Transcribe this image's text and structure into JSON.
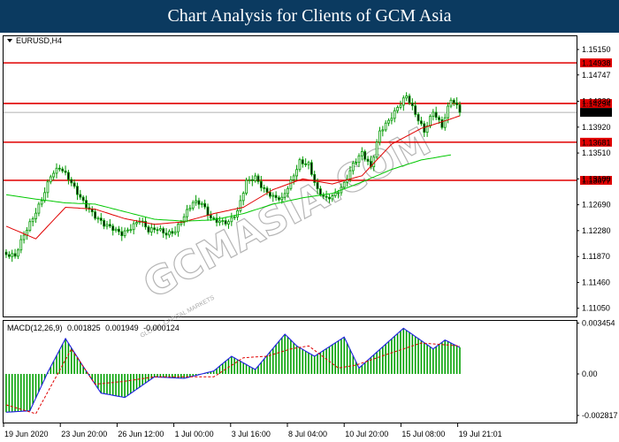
{
  "header": {
    "title": "Chart Analysis for Clients of GCM Asia"
  },
  "watermark": {
    "text": "GCMASIA.COM",
    "subtext": "GLOBAL CAPITAL MARKETS"
  },
  "colors": {
    "banner": "#0b3a60",
    "candle": "#009900",
    "level_line": "#e00000",
    "level_tag": "#e00000",
    "current_tag": "#000000",
    "ma_fast": "#e00000",
    "ma_slow": "#00c800",
    "macd_line": "#2020e0",
    "macd_signal": "#e00000",
    "macd_hist": "#00a000"
  },
  "chart_data": [
    {
      "type": "candlestick",
      "title": "EURUSD,H4",
      "ylim": [
        1.1092,
        1.1536
      ],
      "y_ticks": [
        "1.15150",
        "1.14747",
        "1.14330",
        "1.13920",
        "1.13510",
        "1.13100",
        "1.12690",
        "1.12280",
        "1.11870",
        "1.11460",
        "1.11050"
      ],
      "x_ticks": [
        "19 Jun 2020",
        "23 Jun 20:00",
        "26 Jun 12:00",
        "1 Jul 00:00",
        "3 Jul 16:00",
        "8 Jul 04:00",
        "10 Jul 20:00",
        "15 Jul 08:00",
        "19 Jul 21:01"
      ],
      "levels": [
        "1.14938",
        "1.14294",
        "1.13681",
        "1.13077"
      ],
      "current_price": "1.14154",
      "close_anchors": [
        [
          0,
          1.119
        ],
        [
          3,
          1.1185
        ],
        [
          6,
          1.122
        ],
        [
          9,
          1.125
        ],
        [
          12,
          1.128
        ],
        [
          15,
          1.1315
        ],
        [
          18,
          1.1325
        ],
        [
          21,
          1.131
        ],
        [
          24,
          1.129
        ],
        [
          27,
          1.127
        ],
        [
          30,
          1.125
        ],
        [
          33,
          1.1235
        ],
        [
          36,
          1.123
        ],
        [
          39,
          1.1225
        ],
        [
          42,
          1.1235
        ],
        [
          45,
          1.1245
        ],
        [
          48,
          1.1225
        ],
        [
          51,
          1.123
        ],
        [
          54,
          1.1225
        ],
        [
          57,
          1.123
        ],
        [
          60,
          1.125
        ],
        [
          63,
          1.127
        ],
        [
          66,
          1.127
        ],
        [
          69,
          1.125
        ],
        [
          72,
          1.1245
        ],
        [
          75,
          1.124
        ],
        [
          78,
          1.1255
        ],
        [
          81,
          1.1305
        ],
        [
          84,
          1.1315
        ],
        [
          87,
          1.1295
        ],
        [
          90,
          1.128
        ],
        [
          93,
          1.1275
        ],
        [
          96,
          1.1305
        ],
        [
          99,
          1.134
        ],
        [
          102,
          1.1335
        ],
        [
          105,
          1.129
        ],
        [
          108,
          1.1275
        ],
        [
          111,
          1.1285
        ],
        [
          114,
          1.1305
        ],
        [
          117,
          1.1335
        ],
        [
          120,
          1.135
        ],
        [
          123,
          1.1325
        ],
        [
          126,
          1.1385
        ],
        [
          129,
          1.1405
        ],
        [
          132,
          1.1425
        ],
        [
          135,
          1.144
        ],
        [
          138,
          1.141
        ],
        [
          141,
          1.1385
        ],
        [
          144,
          1.142
        ],
        [
          147,
          1.1395
        ],
        [
          150,
          1.1435
        ],
        [
          153,
          1.1415
        ]
      ],
      "ma_fast_anchors": [
        [
          0,
          1.1235
        ],
        [
          10,
          1.1215
        ],
        [
          20,
          1.1265
        ],
        [
          30,
          1.1262
        ],
        [
          40,
          1.1247
        ],
        [
          50,
          1.1238
        ],
        [
          60,
          1.1242
        ],
        [
          70,
          1.1255
        ],
        [
          80,
          1.1265
        ],
        [
          90,
          1.1293
        ],
        [
          100,
          1.131
        ],
        [
          110,
          1.1302
        ],
        [
          120,
          1.1315
        ],
        [
          130,
          1.1365
        ],
        [
          140,
          1.139
        ],
        [
          150,
          1.1405
        ],
        [
          153,
          1.141
        ]
      ],
      "ma_slow_anchors": [
        [
          0,
          1.1285
        ],
        [
          10,
          1.1278
        ],
        [
          20,
          1.1272
        ],
        [
          30,
          1.127
        ],
        [
          40,
          1.1258
        ],
        [
          50,
          1.1246
        ],
        [
          60,
          1.1243
        ],
        [
          70,
          1.1245
        ],
        [
          80,
          1.1255
        ],
        [
          90,
          1.127
        ],
        [
          100,
          1.128
        ],
        [
          110,
          1.1287
        ],
        [
          120,
          1.1305
        ],
        [
          130,
          1.1325
        ],
        [
          140,
          1.134
        ],
        [
          150,
          1.1348
        ]
      ],
      "bar_count": 154
    },
    {
      "type": "macd",
      "title": "MACD(12,26,9)",
      "values": [
        "0.001825",
        "0.001949",
        "-0.000124"
      ],
      "ylim": [
        -0.0033,
        0.0036
      ],
      "y_ticks": [
        "0.003454",
        "0.00",
        "-0.002817"
      ],
      "macd_anchors": [
        [
          0,
          -0.0026
        ],
        [
          8,
          -0.0025
        ],
        [
          14,
          0.0001
        ],
        [
          20,
          0.0024
        ],
        [
          26,
          0.0005
        ],
        [
          32,
          -0.0013
        ],
        [
          40,
          -0.0016
        ],
        [
          50,
          -0.0002
        ],
        [
          60,
          -0.0003
        ],
        [
          70,
          0.0002
        ],
        [
          76,
          0.0012
        ],
        [
          84,
          0.0003
        ],
        [
          94,
          0.0027
        ],
        [
          98,
          0.0019
        ],
        [
          104,
          0.0012
        ],
        [
          114,
          0.0025
        ],
        [
          119,
          0.0004
        ],
        [
          124,
          0.0013
        ],
        [
          134,
          0.0031
        ],
        [
          144,
          0.0017
        ],
        [
          148,
          0.0023
        ],
        [
          153,
          0.0018
        ]
      ],
      "signal_anchors": [
        [
          0,
          -0.0021
        ],
        [
          10,
          -0.0027
        ],
        [
          22,
          0.0017
        ],
        [
          30,
          -0.0007
        ],
        [
          40,
          -0.0005
        ],
        [
          50,
          -0.0002
        ],
        [
          60,
          -0.0002
        ],
        [
          70,
          -0.0002
        ],
        [
          80,
          0.0011
        ],
        [
          88,
          0.0012
        ],
        [
          96,
          0.0017
        ],
        [
          102,
          0.0019
        ],
        [
          112,
          0.0004
        ],
        [
          118,
          0.0006
        ],
        [
          128,
          0.0013
        ],
        [
          140,
          0.0021
        ],
        [
          153,
          0.0019
        ]
      ]
    }
  ]
}
